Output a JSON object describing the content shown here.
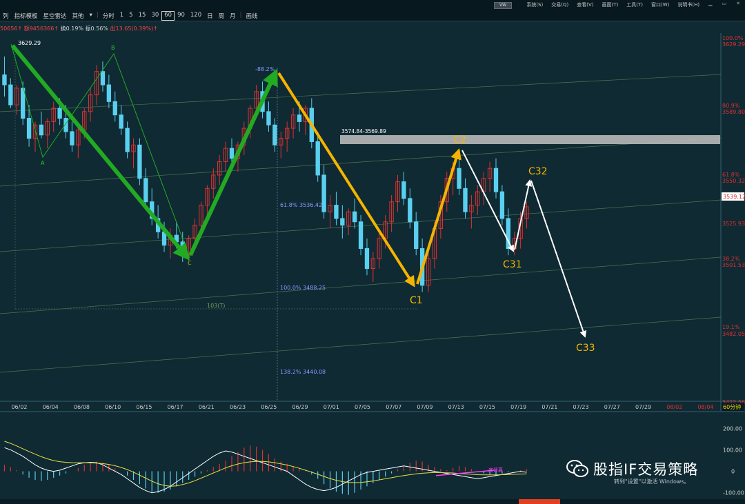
{
  "toolbar": {
    "search_box": "VW",
    "menu": [
      "系统(S)",
      "交易(Q)",
      "查看(V)",
      "画面(T)",
      "工具(T)",
      "窗口(W)",
      "说明书(H)"
    ],
    "period_tabs": [
      "列",
      "指标模板",
      "星空雷达",
      "其他",
      "▾",
      "分时",
      "1",
      "5",
      "15",
      "30",
      "60",
      "90",
      "120",
      "日",
      "周",
      "月",
      "画线"
    ],
    "active_period": "60"
  },
  "info_line": {
    "vol": "50656↑",
    "amount": "额9456366↑",
    "change": "换0.19%",
    "amplitude": "振0.56%",
    "delta": "出13.65(0.39%)↑"
  },
  "colors": {
    "background": "#0f2a33",
    "up_candle": "#e03030",
    "down_candle": "#5ad0f0",
    "green_arrow": "#22aa22",
    "orange_arrow": "#f5b400",
    "white_arrow": "#ffffff",
    "resistance_zone": "#b8b8b8"
  },
  "chart_data": {
    "type": "candlestick",
    "period": "60分钟",
    "ylim": [
      3422.56,
      3643.0
    ],
    "y_scale_labels": [
      "3629.29",
      "3589.80",
      "3550.32",
      "3525.93",
      "3501.53",
      "3482.05",
      "3422.56"
    ],
    "fib_pct_labels": [
      {
        "pct": "100.0%",
        "value": 3629.29
      },
      {
        "pct": "80.9%",
        "value": 3589.8
      },
      {
        "pct": "61.8%",
        "value": 3550.32
      },
      {
        "pct": "38.2%",
        "value": 3501.53
      },
      {
        "pct": "19.1%",
        "value": 3482.05
      }
    ],
    "current_price": "3539.12",
    "current_value": 3539.12,
    "x_dates": [
      "06/02",
      "06/04",
      "06/08",
      "06/10",
      "06/15",
      "06/17",
      "06/21",
      "06/23",
      "06/25",
      "06/29",
      "07/01",
      "07/05",
      "07/07",
      "07/09",
      "07/13",
      "07/15",
      "07/19",
      "07/21",
      "07/23",
      "07/27",
      "07/29",
      "08/02",
      "08/04"
    ],
    "period_label": "60分钟",
    "annotations": {
      "high": "3629.29",
      "zone": "3574.84-3569.89",
      "fib_neg": "-88.2%",
      "fib_618": "61.8% 3536.42",
      "fib_100": "100.0% 3488.25",
      "fib_1382": "138.2% 3440.08",
      "count": "103(T)"
    },
    "wave_labels": [
      "A",
      "B",
      "C",
      "C1",
      "C2",
      "C31",
      "C32",
      "C33"
    ],
    "candles": [
      [
        3618,
        3629,
        3605,
        3612
      ],
      [
        3612,
        3616,
        3598,
        3600
      ],
      [
        3600,
        3612,
        3594,
        3610
      ],
      [
        3610,
        3614,
        3588,
        3592
      ],
      [
        3592,
        3600,
        3575,
        3580
      ],
      [
        3580,
        3590,
        3572,
        3588
      ],
      [
        3588,
        3596,
        3580,
        3582
      ],
      [
        3582,
        3592,
        3574,
        3590
      ],
      [
        3590,
        3602,
        3584,
        3598
      ],
      [
        3598,
        3604,
        3588,
        3592
      ],
      [
        3592,
        3600,
        3580,
        3584
      ],
      [
        3584,
        3590,
        3572,
        3576
      ],
      [
        3576,
        3588,
        3568,
        3585
      ],
      [
        3585,
        3598,
        3580,
        3596
      ],
      [
        3596,
        3610,
        3590,
        3606
      ],
      [
        3606,
        3624,
        3600,
        3620
      ],
      [
        3620,
        3626,
        3608,
        3612
      ],
      [
        3612,
        3618,
        3598,
        3602
      ],
      [
        3602,
        3608,
        3590,
        3594
      ],
      [
        3594,
        3600,
        3582,
        3586
      ],
      [
        3586,
        3590,
        3568,
        3572
      ],
      [
        3572,
        3580,
        3562,
        3576
      ],
      [
        3576,
        3580,
        3552,
        3556
      ],
      [
        3556,
        3562,
        3538,
        3542
      ],
      [
        3542,
        3550,
        3528,
        3532
      ],
      [
        3532,
        3540,
        3520,
        3524
      ],
      [
        3524,
        3530,
        3512,
        3516
      ],
      [
        3516,
        3526,
        3508,
        3522
      ],
      [
        3522,
        3530,
        3514,
        3518
      ],
      [
        3518,
        3524,
        3506,
        3510
      ],
      [
        3510,
        3522,
        3504,
        3520
      ],
      [
        3520,
        3532,
        3514,
        3528
      ],
      [
        3528,
        3542,
        3522,
        3540
      ],
      [
        3540,
        3552,
        3534,
        3550
      ],
      [
        3550,
        3562,
        3544,
        3558
      ],
      [
        3558,
        3570,
        3552,
        3566
      ],
      [
        3566,
        3578,
        3560,
        3574
      ],
      [
        3574,
        3580,
        3562,
        3568
      ],
      [
        3568,
        3578,
        3560,
        3576
      ],
      [
        3576,
        3590,
        3570,
        3586
      ],
      [
        3586,
        3600,
        3580,
        3598
      ],
      [
        3598,
        3612,
        3592,
        3608
      ],
      [
        3608,
        3614,
        3592,
        3596
      ],
      [
        3596,
        3602,
        3584,
        3588
      ],
      [
        3588,
        3592,
        3572,
        3576
      ],
      [
        3576,
        3584,
        3568,
        3580
      ],
      [
        3580,
        3590,
        3572,
        3586
      ],
      [
        3586,
        3598,
        3580,
        3594
      ],
      [
        3594,
        3602,
        3584,
        3590
      ],
      [
        3590,
        3600,
        3582,
        3598
      ],
      [
        3598,
        3604,
        3574,
        3578
      ],
      [
        3578,
        3584,
        3554,
        3558
      ],
      [
        3558,
        3564,
        3532,
        3536
      ],
      [
        3536,
        3546,
        3526,
        3540
      ],
      [
        3540,
        3548,
        3528,
        3532
      ],
      [
        3532,
        3540,
        3520,
        3528
      ],
      [
        3528,
        3538,
        3522,
        3536
      ],
      [
        3536,
        3544,
        3526,
        3530
      ],
      [
        3530,
        3534,
        3510,
        3514
      ],
      [
        3514,
        3520,
        3498,
        3502
      ],
      [
        3502,
        3512,
        3494,
        3508
      ],
      [
        3508,
        3524,
        3502,
        3520
      ],
      [
        3520,
        3534,
        3514,
        3530
      ],
      [
        3530,
        3546,
        3524,
        3542
      ],
      [
        3542,
        3558,
        3536,
        3554
      ],
      [
        3554,
        3560,
        3540,
        3544
      ],
      [
        3544,
        3550,
        3526,
        3530
      ],
      [
        3530,
        3536,
        3510,
        3514
      ],
      [
        3514,
        3520,
        3488,
        3492
      ],
      [
        3492,
        3512,
        3488,
        3508
      ],
      [
        3508,
        3530,
        3502,
        3526
      ],
      [
        3526,
        3546,
        3520,
        3542
      ],
      [
        3542,
        3560,
        3536,
        3556
      ],
      [
        3556,
        3566,
        3546,
        3562
      ],
      [
        3562,
        3570,
        3546,
        3550
      ],
      [
        3550,
        3556,
        3532,
        3536
      ],
      [
        3536,
        3546,
        3526,
        3540
      ],
      [
        3540,
        3552,
        3534,
        3548
      ],
      [
        3548,
        3560,
        3540,
        3556
      ],
      [
        3556,
        3566,
        3548,
        3562
      ],
      [
        3562,
        3568,
        3544,
        3548
      ],
      [
        3548,
        3552,
        3528,
        3532
      ],
      [
        3532,
        3538,
        3510,
        3514
      ],
      [
        3514,
        3524,
        3510,
        3520
      ],
      [
        3520,
        3536,
        3514,
        3532
      ],
      [
        3532,
        3542,
        3526,
        3539
      ]
    ],
    "indicator": {
      "type": "macd",
      "ylim": [
        -130,
        230
      ],
      "y_labels": [
        "200.00",
        "100.00",
        "0",
        "-100.00"
      ],
      "label_values": [
        200,
        100,
        0,
        -100
      ],
      "annotation": "底背离",
      "hist": [
        30,
        20,
        5,
        -15,
        -30,
        -40,
        -45,
        -40,
        -30,
        -20,
        -10,
        0,
        15,
        30,
        40,
        45,
        40,
        30,
        15,
        0,
        -20,
        -40,
        -60,
        -80,
        -95,
        -100,
        -95,
        -85,
        -70,
        -55,
        -40,
        -25,
        -10,
        5,
        20,
        35,
        50,
        70,
        90,
        110,
        120,
        115,
        100,
        80,
        60,
        45,
        35,
        25,
        15,
        5,
        -15,
        -35,
        -60,
        -80,
        -95,
        -105,
        -110,
        -100,
        -85,
        -70,
        -55,
        -40,
        -25,
        -10,
        10,
        25,
        40,
        50,
        45,
        30,
        20,
        10,
        5,
        15,
        25,
        20,
        10,
        0,
        -10,
        -15,
        -20,
        -10,
        -5,
        0,
        5,
        10
      ],
      "dif": [
        110,
        100,
        85,
        70,
        50,
        30,
        15,
        5,
        0,
        5,
        15,
        25,
        35,
        40,
        42,
        40,
        30,
        15,
        0,
        -15,
        -35,
        -55,
        -75,
        -90,
        -100,
        -95,
        -85,
        -70,
        -50,
        -30,
        -10,
        10,
        30,
        50,
        70,
        85,
        95,
        90,
        80,
        70,
        60,
        50,
        40,
        30,
        20,
        10,
        0,
        -20,
        -40,
        -60,
        -75,
        -85,
        -90,
        -85,
        -75,
        -60,
        -45,
        -30,
        -15,
        -5,
        0,
        5,
        10,
        15,
        20,
        25,
        20,
        15,
        10,
        5,
        0,
        -5,
        -10,
        -15,
        -20,
        -25,
        -30,
        -35,
        -30,
        -25,
        -20,
        -15,
        -10,
        -5,
        0,
        -5
      ],
      "dea": [
        140,
        130,
        118,
        105,
        92,
        80,
        68,
        58,
        50,
        45,
        42,
        40,
        40,
        40,
        40,
        38,
        36,
        32,
        26,
        18,
        8,
        -4,
        -18,
        -32,
        -46,
        -58,
        -66,
        -70,
        -68,
        -62,
        -54,
        -44,
        -32,
        -20,
        -8,
        4,
        16,
        26,
        34,
        40,
        44,
        46,
        46,
        44,
        40,
        35,
        29,
        22,
        14,
        5,
        -4,
        -14,
        -24,
        -34,
        -42,
        -48,
        -52,
        -53,
        -52,
        -49,
        -45,
        -40,
        -35,
        -30,
        -25,
        -20,
        -16,
        -12,
        -9,
        -7,
        -6,
        -6,
        -7,
        -8,
        -10,
        -12,
        -14,
        -16,
        -17,
        -17,
        -17,
        -16,
        -15,
        -14,
        -13,
        -12
      ]
    }
  },
  "watermark": "股指IF交易策略",
  "activate_notice": "转到\"设置\"以激活 Windows。"
}
